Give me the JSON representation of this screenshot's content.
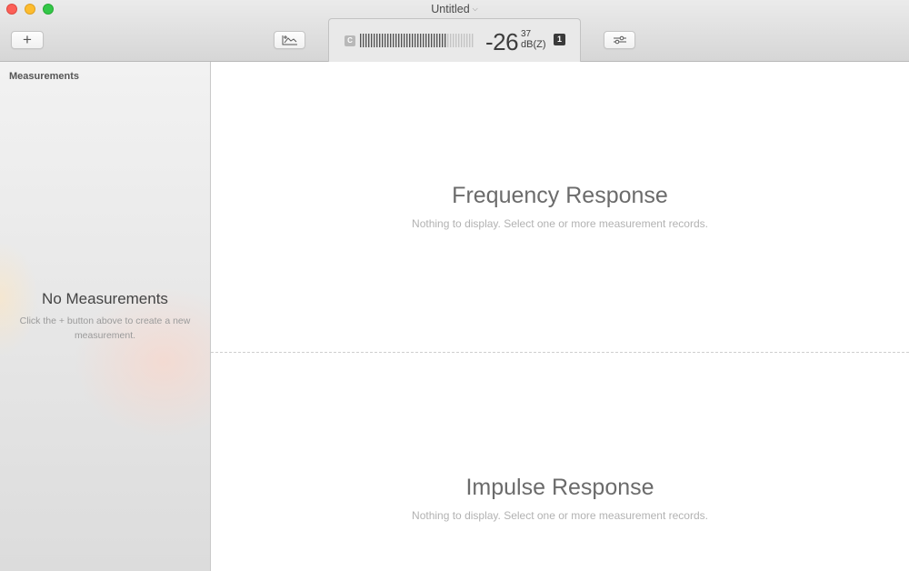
{
  "window": {
    "title": "Untitled",
    "title_caret_icon": "chevron-down-icon"
  },
  "toolbar": {
    "add_button_label": "+",
    "graph_button_icon": "graph-icon",
    "settings_button_icon": "sliders-icon"
  },
  "meter": {
    "weighting_badge": "C",
    "value_integer": "-26",
    "value_decimal": "37",
    "unit": "dB(Z)",
    "channel_badge": "1",
    "fill_fraction": 0.75
  },
  "sidebar": {
    "header": "Measurements",
    "empty_title": "No Measurements",
    "empty_hint_before": "Click the",
    "empty_hint_plus": "+",
    "empty_hint_after": "button above to create a new measurement."
  },
  "main": {
    "frequency_title": "Frequency Response",
    "frequency_subtitle": "Nothing to display. Select one or more measurement records.",
    "impulse_title": "Impulse Response",
    "impulse_subtitle": "Nothing to display. Select one or more measurement records."
  }
}
